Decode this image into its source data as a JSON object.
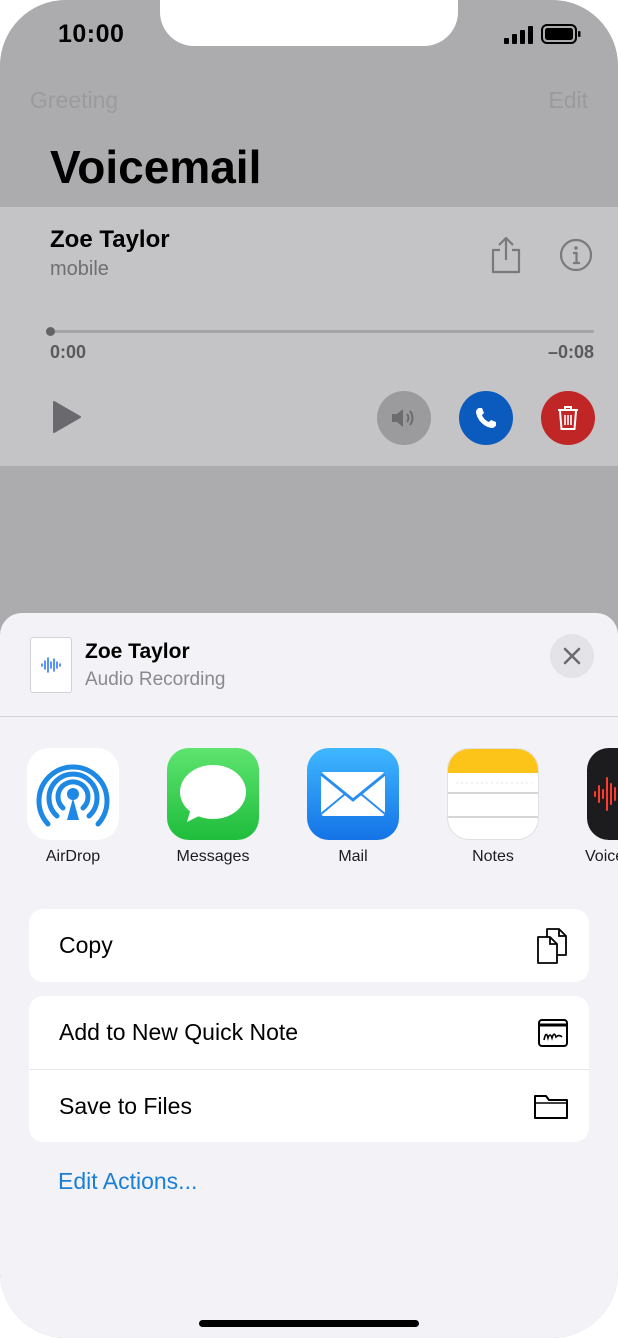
{
  "status": {
    "time": "10:00"
  },
  "nav": {
    "left": "Greeting",
    "right": "Edit"
  },
  "page_title": "Voicemail",
  "voicemail": {
    "name": "Zoe Taylor",
    "label": "mobile",
    "time_start": "0:00",
    "time_remaining": "–0:08",
    "progress": 0
  },
  "share_sheet": {
    "file_title": "Zoe Taylor",
    "file_subtitle": "Audio Recording",
    "apps": [
      {
        "label": "AirDrop",
        "icon": "airdrop-icon"
      },
      {
        "label": "Messages",
        "icon": "messages-icon"
      },
      {
        "label": "Mail",
        "icon": "mail-icon"
      },
      {
        "label": "Notes",
        "icon": "notes-icon"
      },
      {
        "label": "Voice",
        "icon": "voice-memos-icon"
      }
    ],
    "actions_group1": [
      {
        "label": "Copy",
        "icon": "copy-icon"
      }
    ],
    "actions_group2": [
      {
        "label": "Add to New Quick Note",
        "icon": "quick-note-icon"
      },
      {
        "label": "Save to Files",
        "icon": "folder-icon"
      }
    ],
    "edit_actions": "Edit Actions..."
  },
  "colors": {
    "accent": "#1a7fd6",
    "call": "#0a5bbd",
    "delete": "#c12626",
    "messages": "#34c759"
  }
}
